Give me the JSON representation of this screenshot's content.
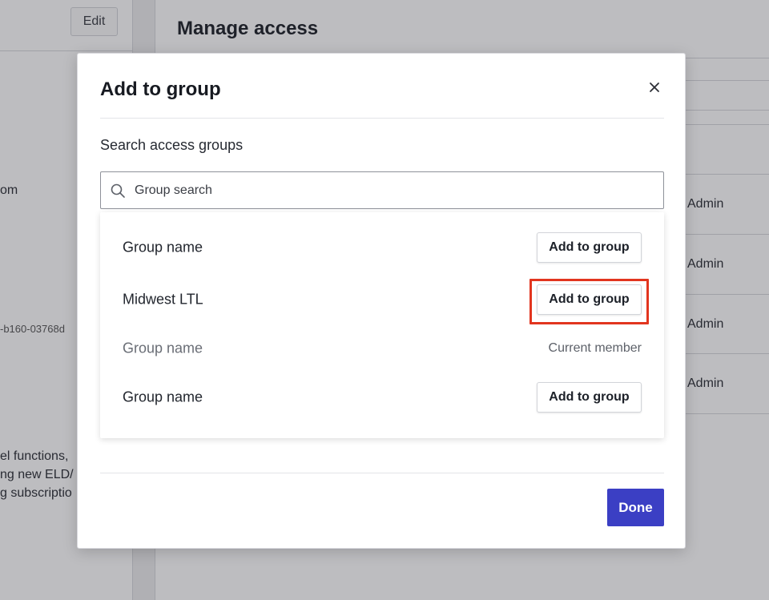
{
  "background": {
    "edit_label": "Edit",
    "page_title": "Manage access",
    "left_fragments": [
      "om",
      "-b160-03768d",
      "el functions,",
      "ng new ELD/",
      "g subscriptio"
    ],
    "admin_labels": [
      "Admin",
      "Admin",
      "Admin",
      "Admin"
    ]
  },
  "modal": {
    "title": "Add to group",
    "close_icon": "close-icon",
    "search_label": "Search access groups",
    "search_placeholder": "Group search",
    "search_value": "",
    "rows": [
      {
        "name": "Group name",
        "action": "Add to group",
        "state": "available"
      },
      {
        "name": "Midwest LTL",
        "action": "Add to group",
        "state": "available"
      },
      {
        "name": "Group name",
        "status": "Current member",
        "state": "member"
      },
      {
        "name": "Group name",
        "action": "Add to group",
        "state": "available"
      }
    ],
    "done_label": "Done"
  },
  "colors": {
    "primary": "#3b3fc4",
    "highlight": "#e2351f",
    "overlay": "#232630"
  }
}
